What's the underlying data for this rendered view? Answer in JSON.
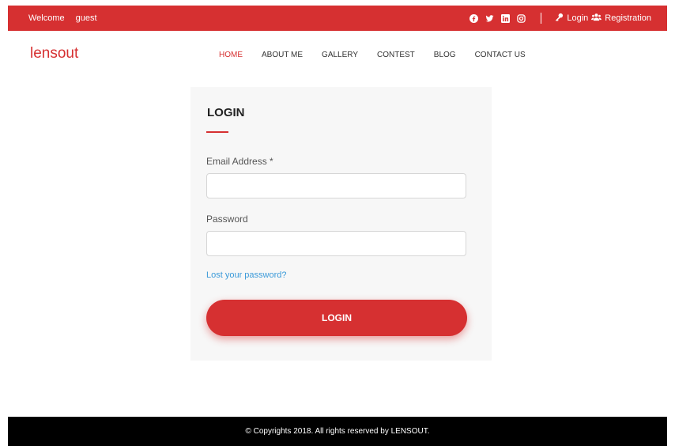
{
  "topbar": {
    "welcome": "Welcome",
    "user": "guest",
    "social_icons": [
      "facebook-icon",
      "twitter-icon",
      "linkedin-icon",
      "instagram-icon"
    ],
    "login_label": "Login",
    "register_label": "Registration"
  },
  "header": {
    "logo": "lensout",
    "nav": [
      {
        "label": "HOME",
        "active": true
      },
      {
        "label": "ABOUT ME",
        "active": false
      },
      {
        "label": "GALLERY",
        "active": false
      },
      {
        "label": "CONTEST",
        "active": false
      },
      {
        "label": "BLOG",
        "active": false
      },
      {
        "label": "CONTACT US",
        "active": false
      }
    ]
  },
  "login_form": {
    "title": "LOGIN",
    "email_label": "Email Address *",
    "email_value": "",
    "password_label": "Password",
    "password_value": "",
    "lost_password": "Lost your password?",
    "submit_label": "LOGIN"
  },
  "footer": {
    "copyright": "© Copyrights 2018. All rights reserved by LENSOUT."
  },
  "colors": {
    "brand": "#d63031",
    "link": "#3b9ad9",
    "card_bg": "#f7f7f7",
    "footer_bg": "#000000"
  }
}
